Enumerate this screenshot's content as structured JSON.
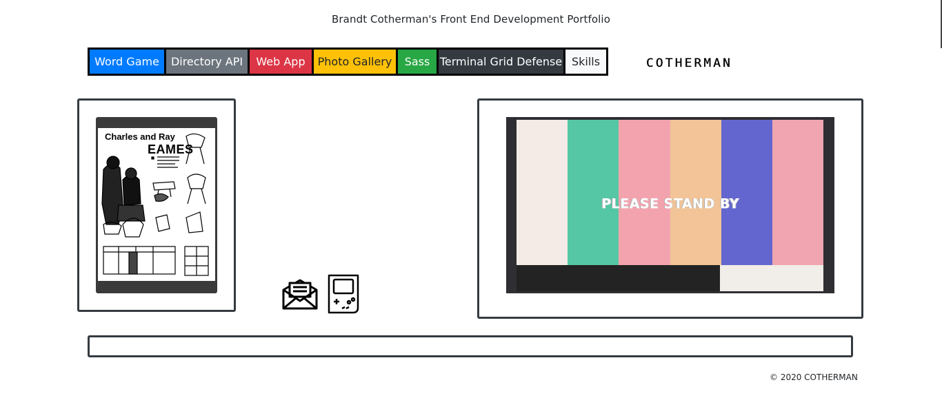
{
  "header": {
    "title": "Brandt Cotherman's Front End Development Portfolio"
  },
  "nav": {
    "items": [
      {
        "label": "Word Game",
        "color": "#007bff"
      },
      {
        "label": "Directory API",
        "color": "#6c757d"
      },
      {
        "label": "Web App",
        "color": "#dc3545"
      },
      {
        "label": "Photo Gallery",
        "color": "#ffc107"
      },
      {
        "label": "Sass",
        "color": "#28a745"
      },
      {
        "label": "Terminal Grid Defense",
        "color": "#343a40"
      },
      {
        "label": "Skills",
        "color": "#f8f9fa"
      }
    ]
  },
  "logo": {
    "text": "COTHERMAN"
  },
  "left_card": {
    "poster_line1": "Charles and Ray",
    "poster_line2": "EAMES"
  },
  "icons": {
    "mail": "envelope-icon",
    "game": "gameboy-icon"
  },
  "right_card": {
    "standby_text": "PLEASE STAND BY",
    "bar_colors": [
      "#f4ebe6",
      "#55c7a4",
      "#f3a3ae",
      "#f2c497",
      "#6466cf",
      "#f1a5b0"
    ]
  },
  "footer": {
    "copyright": "© 2020 COTHERMAN"
  }
}
